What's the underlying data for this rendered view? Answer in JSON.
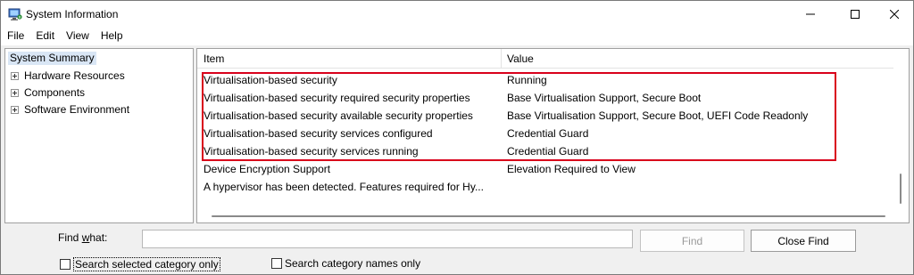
{
  "window": {
    "title": "System Information",
    "minimize_label": "—",
    "maximize_label": "☐",
    "close_label": "✕"
  },
  "menu": [
    "File",
    "Edit",
    "View",
    "Help"
  ],
  "tree": {
    "root": "System Summary",
    "children": [
      "Hardware Resources",
      "Components",
      "Software Environment"
    ]
  },
  "list": {
    "columns": [
      "Item",
      "Value"
    ],
    "rows": [
      {
        "item": "Virtualisation-based security",
        "value": "Running"
      },
      {
        "item": "Virtualisation-based security required security properties",
        "value": "Base Virtualisation Support, Secure Boot"
      },
      {
        "item": "Virtualisation-based security available security properties",
        "value": "Base Virtualisation Support, Secure Boot, UEFI Code Readonly"
      },
      {
        "item": "Virtualisation-based security services configured",
        "value": "Credential Guard"
      },
      {
        "item": "Virtualisation-based security services running",
        "value": "Credential Guard"
      },
      {
        "item": "Device Encryption Support",
        "value": "Elevation Required to View"
      },
      {
        "item": "A hypervisor has been detected. Features required for Hy...",
        "value": ""
      }
    ],
    "highlight_color": "#d9001b"
  },
  "find": {
    "label_prefix": "Find ",
    "label_underlined": "w",
    "label_suffix": "hat:",
    "input_value": "",
    "find_button": "Find",
    "close_find_button": "Close Find",
    "search_selected_label": "Search selected category only",
    "search_names_label": "Search category names only",
    "search_selected_checked": false,
    "search_names_checked": false
  },
  "icons": {
    "app": "system-info-icon",
    "expander": "plus-expander-icon"
  }
}
